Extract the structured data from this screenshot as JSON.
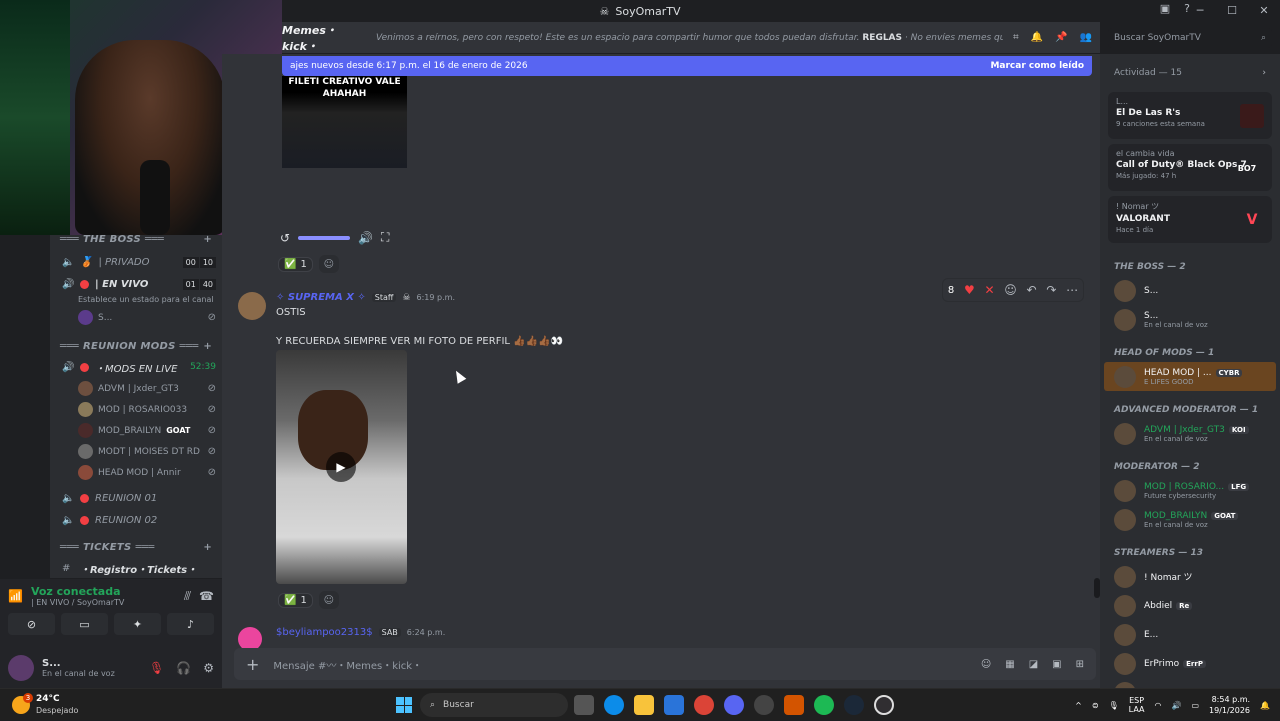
{
  "window": {
    "title": "SoyOmarTV"
  },
  "header": {
    "channel": "Memes・kick・",
    "topic": "Venimos a reírnos, pero con respeto! Este es un espacio para compartir humor que todos puedan disfrutar.",
    "topic_rules": "REGLAS",
    "topic_rest": "· No envíes memes que conten…",
    "search_placeholder": "Buscar SoyOmarTV"
  },
  "channels": {
    "cat_boss": "THE BOSS",
    "privado": "| PRIVADO",
    "privado_counts": [
      "00",
      "10"
    ],
    "envivo": "| EN VIVO",
    "envivo_counts": [
      "01",
      "40"
    ],
    "status_note": "Establece un estado para el canal",
    "envivo_member": "S...",
    "cat_reunion": "REUNION MODS",
    "mods_live": "・MODS EN LIVE",
    "mods_time": "52:39",
    "members": [
      "ADVM | Jxder_GT3",
      "MOD | ROSARIO033",
      "MOD_BRAILYN",
      "MODT | MOISES DT RD",
      "HEAD MOD | Annir"
    ],
    "goat": "GOAT",
    "reunion01": "REUNION 01",
    "reunion02": "REUNION 02",
    "cat_tickets": "TICKETS",
    "registro": "・Registro・Tickets・"
  },
  "voice": {
    "connected": "Voz conectada",
    "sub": "| EN VIVO / SoyOmarTV"
  },
  "user": {
    "name": "S...",
    "status": "En el canal de voz"
  },
  "newbar": {
    "text": "ajes nuevos desde 6:17 p.m. el 16 de enero de 2026",
    "mark": "Marcar como leído"
  },
  "vid1_caption": [
    "FILETI CREATIVO VALE",
    "AHAHAH"
  ],
  "reaction1": {
    "emoji": "✅",
    "count": "1"
  },
  "msg1": {
    "author": "✧ SUPREMA X ✧",
    "badge": "Staff",
    "time": "6:19 p.m.",
    "line1": "OSTIS",
    "line2": "Y RECUERDA SIEMPRE VER MI FOTO DE PERFIL 👍🏾👍🏾👍🏾👀"
  },
  "hover_count": "8",
  "reaction2": {
    "emoji": "✅",
    "count": "1"
  },
  "msg2": {
    "author": "$beyliampoo2313$",
    "badge": "SAB",
    "time": "6:24 p.m."
  },
  "composer": {
    "placeholder": "Mensaje #〰・Memes・kick・"
  },
  "activity": {
    "title": "Actividad — 15",
    "cards": [
      {
        "who": "L...",
        "what": "El De Las R's",
        "detail": "9 canciones esta semana",
        "art": ""
      },
      {
        "who": "el cambia vida",
        "what": "Call of Duty® Black Ops 7",
        "detail": "Más jugado: 47 h",
        "art": "BO7"
      },
      {
        "who": "! Nomar ツ",
        "what": "VALORANT",
        "detail": "Hace 1 día",
        "art": "V"
      }
    ]
  },
  "groups": [
    {
      "title": "THE BOSS — 2",
      "members": [
        {
          "name": "S...",
          "sub": "",
          "chip": ""
        },
        {
          "name": "S...",
          "sub": "En el canal de voz",
          "chip": ""
        }
      ]
    },
    {
      "title": "HEAD OF MODS — 1",
      "members": [
        {
          "name": "HEAD MOD | ...",
          "sub": "E LIFES GOOD",
          "chip": "CYBR"
        }
      ]
    },
    {
      "title": "ADVANCED MODERATOR — 1",
      "members": [
        {
          "name": "ADVM | Jxder_GT3",
          "sub": "En el canal de voz",
          "chip": "KOI"
        }
      ]
    },
    {
      "title": "MODERATOR — 2",
      "members": [
        {
          "name": "MOD | ROSARIO...",
          "sub": "Future cybersecurity",
          "chip": "LFG"
        },
        {
          "name": "MOD_BRAILYN",
          "sub": "En el canal de voz",
          "chip": "GOAT"
        }
      ]
    },
    {
      "title": "STREAMERS — 13",
      "members": [
        {
          "name": "! Nomar ツ",
          "sub": "",
          "chip": ""
        },
        {
          "name": "Abdiel",
          "sub": "",
          "chip": "Re"
        },
        {
          "name": "E...",
          "sub": "",
          "chip": ""
        },
        {
          "name": "ErPrimo",
          "sub": "",
          "chip": "ErrP"
        },
        {
          "name": "F...",
          "sub": "",
          "chip": ""
        }
      ]
    }
  ],
  "taskbar": {
    "temp": "24°C",
    "weather": "Despejado",
    "weather_badge": "3",
    "search": "Buscar",
    "lang1": "ESP",
    "lang2": "LAA",
    "time": "8:54 p.m.",
    "date": "19/1/2026"
  },
  "colors": {
    "accent": "#5865f2",
    "online": "#23a55a",
    "danger": "#f23f43"
  }
}
